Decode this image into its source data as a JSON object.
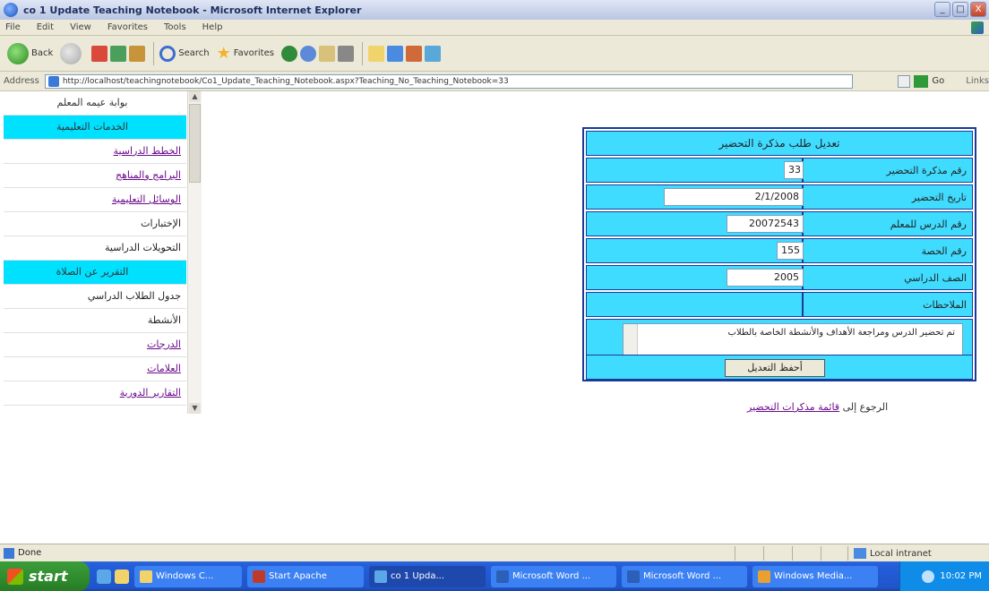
{
  "window": {
    "title": "co 1 Update Teaching Notebook - Microsoft Internet Explorer",
    "controls": [
      "_",
      "□",
      "X"
    ]
  },
  "menubar": {
    "items": [
      "File",
      "Edit",
      "View",
      "Favorites",
      "Tools",
      "Help"
    ]
  },
  "toolbar": {
    "back_label": "Back",
    "search_label": "Search",
    "favorites_label": "Favorites"
  },
  "address": {
    "label": "Address",
    "url": "http://localhost/teachingnotebook/Co1_Update_Teaching_Notebook.aspx?Teaching_No_Teaching_Notebook=33",
    "go_label": "Go",
    "links_label": "Links"
  },
  "sidebar": {
    "items": [
      {
        "label": "بوابة عيمه المعلم",
        "style": "plain"
      },
      {
        "label": "الخدمات التعليمية",
        "style": "header"
      },
      {
        "label": "الخطط الدراسية",
        "style": "link"
      },
      {
        "label": "البرامج والمناهج",
        "style": "link"
      },
      {
        "label": "الوسائل التعليمية",
        "style": "link"
      },
      {
        "label": "الإختبارات",
        "style": "dark"
      },
      {
        "label": "التحويلات الدراسية",
        "style": "dark"
      },
      {
        "label": "التقرير عن الصلاة",
        "style": "header"
      },
      {
        "label": "جدول الطلاب الدراسي",
        "style": "dark"
      },
      {
        "label": "الأنشطة",
        "style": "dark"
      },
      {
        "label": "الدرجات",
        "style": "link"
      },
      {
        "label": "العلامات",
        "style": "link"
      },
      {
        "label": "التقارير الدورية",
        "style": "link"
      }
    ]
  },
  "form": {
    "title": "تعديل طلب مذكرة التحضير",
    "rows": [
      {
        "label": "رقم مذكرة التحضير",
        "value": "33"
      },
      {
        "label": "تاريخ التحضير",
        "value": "2/1/2008"
      },
      {
        "label": "رقم الدرس للمعلم",
        "value": "20072543"
      },
      {
        "label": "رقم الحصة",
        "value": "155"
      },
      {
        "label": "الصف الدراسي",
        "value": "2005"
      },
      {
        "label": "الملاحظات",
        "value": ""
      }
    ],
    "notes_text": "تم تحضير الدرس ومراجعة الأهداف والأنشطة الخاصة بالطلاب",
    "save_label": "أحفظ التعديل"
  },
  "footer": {
    "prefix": "الرجوع إلى",
    "link_text": "قائمة مذكرات التحضير"
  },
  "statusbar": {
    "status": "Done",
    "zone": "Local intranet"
  },
  "taskbar": {
    "start_label": "start",
    "tasks": [
      {
        "label": "Windows C...",
        "active": false
      },
      {
        "label": "Start Apache",
        "active": false
      },
      {
        "label": "co 1 Upda...",
        "active": true
      },
      {
        "label": "Microsoft Word ...",
        "active": false
      },
      {
        "label": "Microsoft Word ...",
        "active": false
      },
      {
        "label": "Windows Media...",
        "active": false
      }
    ],
    "clock": "10:02 PM"
  }
}
